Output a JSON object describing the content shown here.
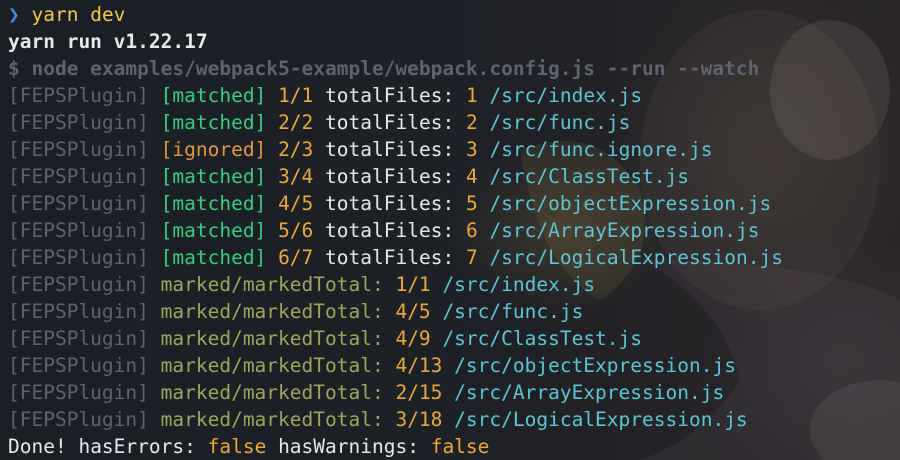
{
  "prompt": {
    "symbol": "❯",
    "command": "yarn dev"
  },
  "yarn_version_line": "yarn run v1.22.17",
  "exec_line": "$ node examples/webpack5-example/webpack.config.js --run --watch",
  "plugin_tag": "[FEPSPlugin]",
  "file_lines": [
    {
      "status": "[matched]",
      "progress": "1/1",
      "label": "totalFiles:",
      "total": "1",
      "path": "/src/index.js"
    },
    {
      "status": "[matched]",
      "progress": "2/2",
      "label": "totalFiles:",
      "total": "2",
      "path": "/src/func.js"
    },
    {
      "status": "[ignored]",
      "progress": "2/3",
      "label": "totalFiles:",
      "total": "3",
      "path": "/src/func.ignore.js"
    },
    {
      "status": "[matched]",
      "progress": "3/4",
      "label": "totalFiles:",
      "total": "4",
      "path": "/src/ClassTest.js"
    },
    {
      "status": "[matched]",
      "progress": "4/5",
      "label": "totalFiles:",
      "total": "5",
      "path": "/src/objectExpression.js"
    },
    {
      "status": "[matched]",
      "progress": "5/6",
      "label": "totalFiles:",
      "total": "6",
      "path": "/src/ArrayExpression.js"
    },
    {
      "status": "[matched]",
      "progress": "6/7",
      "label": "totalFiles:",
      "total": "7",
      "path": "/src/LogicalExpression.js"
    }
  ],
  "marked_lines": [
    {
      "label": "marked/markedTotal:",
      "value": "1/1",
      "path": "/src/index.js"
    },
    {
      "label": "marked/markedTotal:",
      "value": "4/5",
      "path": "/src/func.js"
    },
    {
      "label": "marked/markedTotal:",
      "value": "4/9",
      "path": "/src/ClassTest.js"
    },
    {
      "label": "marked/markedTotal:",
      "value": "4/13",
      "path": "/src/objectExpression.js"
    },
    {
      "label": "marked/markedTotal:",
      "value": "2/15",
      "path": "/src/ArrayExpression.js"
    },
    {
      "label": "marked/markedTotal:",
      "value": "3/18",
      "path": "/src/LogicalExpression.js"
    }
  ],
  "done_line": {
    "done": "Done!",
    "errors_label": "hasErrors:",
    "errors_value": "false",
    "warnings_label": "hasWarnings:",
    "warnings_value": "false"
  },
  "colors": {
    "background": "#1b1f26",
    "prompt_chevron": "#3b8eea",
    "command": "#f3c945",
    "dim_tag": "#5d6470",
    "matched": "#33d17a",
    "ignored": "#e8953a",
    "number": "#f0a830",
    "path": "#56c8d8",
    "marked_label": "#9fa757"
  }
}
